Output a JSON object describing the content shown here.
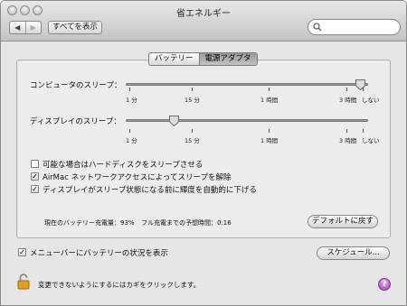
{
  "window": {
    "title": "省エネルギー"
  },
  "toolbar": {
    "back_glyph": "◀",
    "forward_glyph": "▶",
    "show_all_label": "すべてを表示",
    "search_placeholder": ""
  },
  "tabs": [
    {
      "label": "バッテリー",
      "selected": false
    },
    {
      "label": "電源アダプタ",
      "selected": true
    }
  ],
  "computer_sleep": {
    "label": "コンピュータのスリープ：",
    "level": 0.97,
    "ticks": [
      "1 分",
      "15 分",
      "1 時間",
      "3 時間",
      "しない"
    ]
  },
  "display_sleep": {
    "label": "ディスプレイのスリープ：",
    "level": 0.2,
    "ticks": [
      "1 分",
      "15 分",
      "1 時間",
      "3 時間",
      "しない"
    ]
  },
  "options": [
    {
      "label": "可能な場合はハードディスクをスリープさせる",
      "checked": false
    },
    {
      "label": "AirMac ネットワークアクセスによってスリープを解除",
      "checked": true
    },
    {
      "label": "ディスプレイがスリープ状態になる前に輝度を自動的に下げる",
      "checked": true
    }
  ],
  "status": {
    "battery_charge": "現在のバッテリー充電量：93%",
    "full_charge_time": "フル充電までの予想時間：0:16"
  },
  "defaults_button": "デフォルトに戻す",
  "menubar_option": {
    "label": "メニューバーにバッテリーの状況を表示",
    "checked": true
  },
  "schedule_button": "スケジュール...",
  "lock": {
    "text": "変更できないようにするにはカギをクリックします。"
  },
  "help_glyph": "?",
  "colors": {
    "lock_body": "#e0a028",
    "help_purple": "#9a3aa8"
  }
}
